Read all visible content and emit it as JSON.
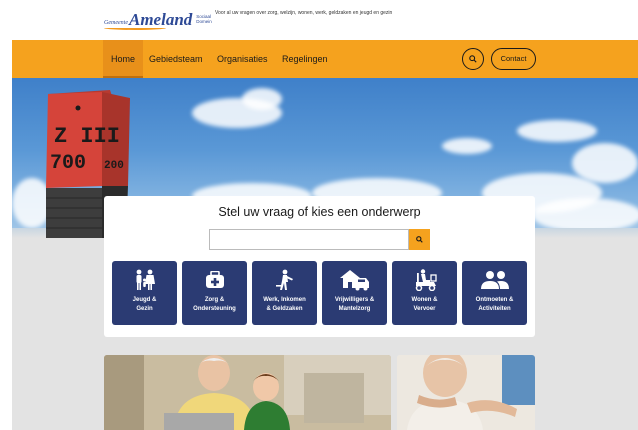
{
  "header": {
    "logo_prefix": "Gemeente",
    "logo_name": "Ameland",
    "logo_sub": "Sociaal Domein",
    "tagline": "Voor al uw vragen over zorg, welzijn, wonen, werk, geldzaken en jeugd en gezin"
  },
  "nav": {
    "items": [
      {
        "label": "Home",
        "active": true
      },
      {
        "label": "Gebiedsteam"
      },
      {
        "label": "Organisaties"
      },
      {
        "label": "Regelingen"
      }
    ],
    "search_icon": "search-icon",
    "contact_label": "Contact"
  },
  "hero": {
    "post_text_line1": "Z III",
    "post_text_line2": "700",
    "post_side_text": "200"
  },
  "search": {
    "title": "Stel uw vraag of kies een onderwerp",
    "placeholder": "",
    "button_icon": "search-icon"
  },
  "topics": [
    {
      "icon": "family-icon",
      "line1": "Jeugd &",
      "line2": "Gezin"
    },
    {
      "icon": "first-aid-kit-icon",
      "line1": "Zorg &",
      "line2": "Ondersteuning"
    },
    {
      "icon": "worker-icon",
      "line1": "Werk, Inkomen",
      "line2": "& Geldzaken"
    },
    {
      "icon": "house-car-icon",
      "line1": "Vrijwilligers &",
      "line2": "Mantelzorg"
    },
    {
      "icon": "mobility-scooter-icon",
      "line1": "Wonen &",
      "line2": "Vervoer"
    },
    {
      "icon": "people-icon",
      "line1": "Ontmoeten &",
      "line2": "Activiteiten"
    }
  ],
  "colors": {
    "nav": "#f5a21e",
    "tile": "#2b3b73",
    "brand": "#2e4a96"
  }
}
